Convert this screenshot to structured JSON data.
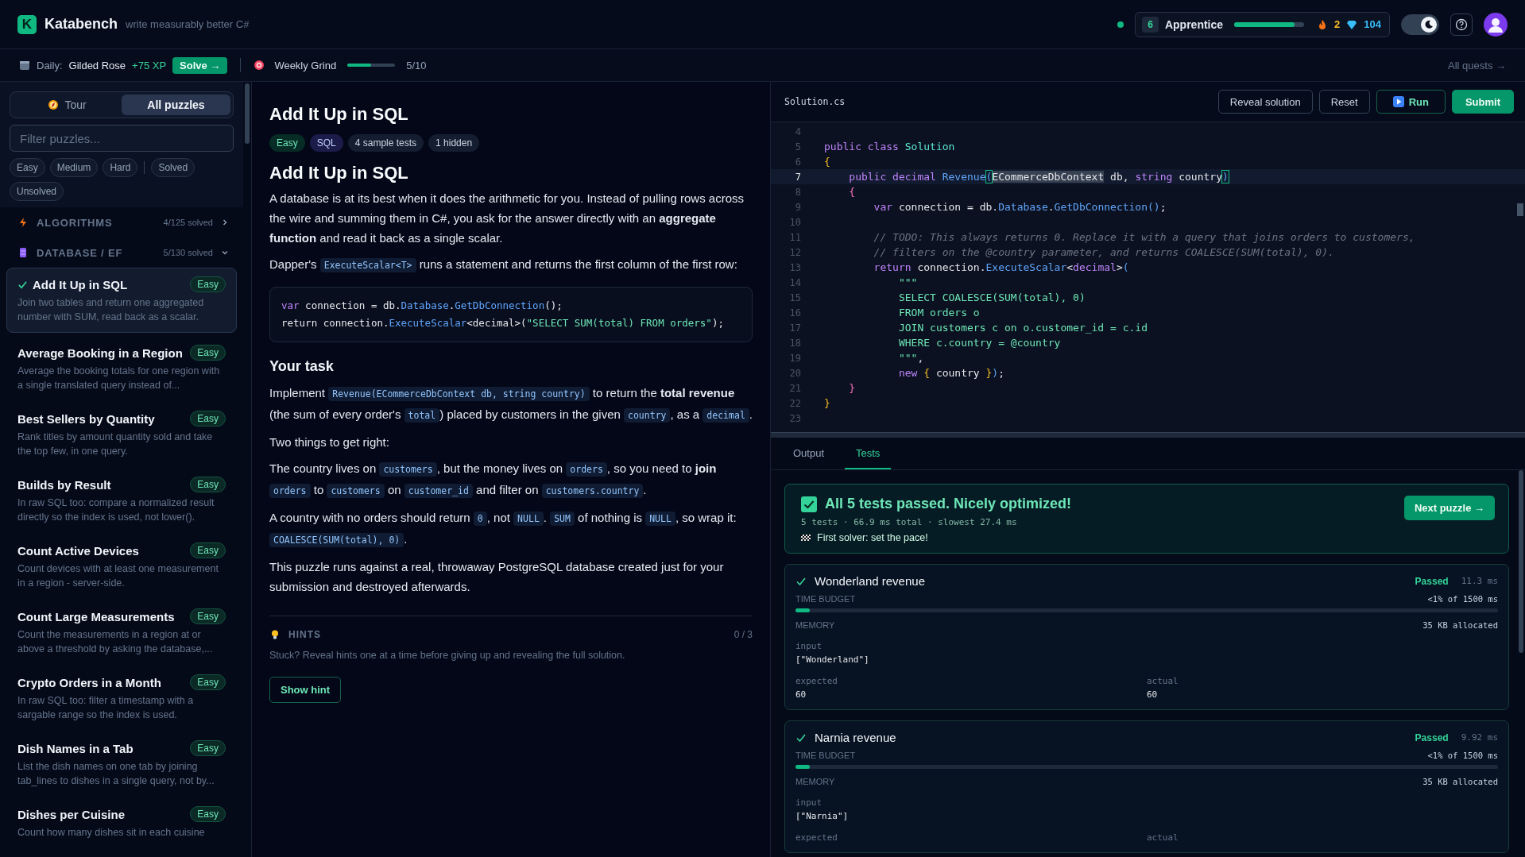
{
  "header": {
    "logo_letter": "K",
    "brand": "Katabench",
    "tagline": "write measurably better C#",
    "online": true,
    "rank_level": "6",
    "rank": "Apprentice",
    "xp": {
      "level": 0.86
    },
    "streak": "2",
    "gems": "104",
    "dark_mode": true
  },
  "quest_bar": {
    "daily_label": "Daily:",
    "daily_name": "Gilded Rose",
    "daily_xp": "+75 XP",
    "solve_button": "Solve →",
    "weekly_name": "Weekly Grind",
    "weekly": {
      "level": 0.5
    },
    "weekly_count": "5/10",
    "all_link": "All quests →"
  },
  "sidebar": {
    "view_tabs": [
      {
        "label": "Tour",
        "selected": false
      },
      {
        "label": "All puzzles",
        "selected": true
      }
    ],
    "filter": {
      "placeholder": "Filter puzzles..."
    },
    "chip_groups": [
      [
        "Easy",
        "Medium",
        "Hard"
      ],
      [
        "Solved",
        "Unsolved"
      ]
    ],
    "categories": [
      {
        "name": "ALGORITHMS",
        "solved": "4/125 solved",
        "expanded": false
      },
      {
        "name": "DATABASE / EF",
        "solved": "5/130 solved",
        "expanded": true,
        "items": [
          {
            "title": "Add It Up in SQL",
            "badge": "Easy",
            "description": "Join two tables and return one aggregated number with SUM, read back as a scalar.",
            "solved": true,
            "selected": true
          },
          {
            "title": "Average Booking in a Region",
            "badge": "Easy",
            "description": "Average the booking totals for one region with a single translated query instead of...",
            "solved": false,
            "selected": false
          },
          {
            "title": "Best Sellers by Quantity",
            "badge": "Easy",
            "description": "Rank titles by amount quantity sold and take the top few, in one query.",
            "solved": false,
            "selected": false
          },
          {
            "title": "Builds by Result",
            "badge": "Easy",
            "description": "In raw SQL too: compare a normalized result directly so the index is used, not lower().",
            "solved": false,
            "selected": false
          },
          {
            "title": "Count Active Devices",
            "badge": "Easy",
            "description": "Count devices with at least one measurement in a region - server-side.",
            "solved": false,
            "selected": false
          },
          {
            "title": "Count Large Measurements",
            "badge": "Easy",
            "description": "Count the measurements in a region at or above a threshold by asking the database,...",
            "solved": false,
            "selected": false
          },
          {
            "title": "Crypto Orders in a Month",
            "badge": "Easy",
            "description": "In raw SQL too: filter a timestamp with a sargable range so the index is used.",
            "solved": false,
            "selected": false
          },
          {
            "title": "Dish Names in a Tab",
            "badge": "Easy",
            "description": "List the dish names on one tab by joining tab_lines to dishes in a single query, not by...",
            "solved": false,
            "selected": false
          },
          {
            "title": "Dishes per Cuisine",
            "badge": "Easy",
            "description": "Count how many dishes sit in each cuisine",
            "solved": false,
            "selected": false
          }
        ]
      }
    ]
  },
  "puzzle": {
    "title": "Add It Up in SQL",
    "tags": [
      {
        "label": "Easy",
        "kind": "difficulty"
      },
      {
        "label": "SQL",
        "kind": "language"
      },
      {
        "label": "4 sample tests",
        "kind": "info"
      },
      {
        "label": "1 hidden",
        "kind": "info"
      }
    ],
    "blocks": [
      {
        "kind": "h2",
        "text": "Add It Up in SQL"
      },
      {
        "kind": "p",
        "parts": [
          {
            "kind": "text",
            "t": "A database is at its best when it does the arithmetic for you. Instead of pulling rows across the wire and summing them in C#, you ask for the answer directly with an **aggregate function** and read it back as a single scalar."
          }
        ]
      },
      {
        "kind": "p",
        "parts": [
          {
            "kind": "text",
            "t": "Dapper's "
          },
          {
            "kind": "code",
            "t": "ExecuteScalar<T>"
          },
          {
            "kind": "text",
            "t": " runs a statement and returns the first column of the first row:"
          }
        ]
      },
      {
        "kind": "code",
        "lines": [
          [
            {
              "kind": "kw",
              "t": "var "
            },
            {
              "kind": "plain",
              "t": "connection = db."
            },
            {
              "kind": "fn",
              "t": "Database"
            },
            {
              "kind": "plain",
              "t": "."
            },
            {
              "kind": "fn",
              "t": "GetDbConnection"
            },
            {
              "kind": "plain",
              "t": "();"
            }
          ],
          [
            {
              "kind": "plain",
              "t": "return connection."
            },
            {
              "kind": "fn",
              "t": "ExecuteScalar"
            },
            {
              "kind": "plain",
              "t": "<decimal>("
            },
            {
              "kind": "str",
              "t": "\"SELECT SUM(total) FROM orders\""
            },
            {
              "kind": "plain",
              "t": ");"
            }
          ]
        ]
      },
      {
        "kind": "h3",
        "text": "Your task"
      },
      {
        "kind": "p",
        "parts": [
          {
            "kind": "text",
            "t": "Implement "
          },
          {
            "kind": "code",
            "t": "Revenue(ECommerceDbContext db, string country)"
          },
          {
            "kind": "text",
            "t": " to return the **total revenue** (the sum of every order's "
          },
          {
            "kind": "code",
            "t": "total"
          },
          {
            "kind": "text",
            "t": ") placed by customers in the given "
          },
          {
            "kind": "code",
            "t": "country"
          },
          {
            "kind": "text",
            "t": ", as a "
          },
          {
            "kind": "code",
            "t": "decimal"
          },
          {
            "kind": "text",
            "t": "."
          }
        ]
      },
      {
        "kind": "p",
        "parts": [
          {
            "kind": "text",
            "t": "Two things to get right:"
          }
        ]
      },
      {
        "kind": "p",
        "parts": [
          {
            "kind": "text",
            "t": "The country lives on "
          },
          {
            "kind": "code",
            "t": "customers"
          },
          {
            "kind": "text",
            "t": ", but the money lives on "
          },
          {
            "kind": "code",
            "t": "orders"
          },
          {
            "kind": "text",
            "t": ", so you need to **join** "
          },
          {
            "kind": "code",
            "t": "orders"
          },
          {
            "kind": "text",
            "t": " to "
          },
          {
            "kind": "code",
            "t": "customers"
          },
          {
            "kind": "text",
            "t": " on "
          },
          {
            "kind": "code",
            "t": "customer_id"
          },
          {
            "kind": "text",
            "t": " and filter on "
          },
          {
            "kind": "code",
            "t": "customers.country"
          },
          {
            "kind": "text",
            "t": "."
          }
        ]
      },
      {
        "kind": "p",
        "parts": [
          {
            "kind": "text",
            "t": "A country with no orders should return "
          },
          {
            "kind": "code",
            "t": "0"
          },
          {
            "kind": "text",
            "t": ", not "
          },
          {
            "kind": "code",
            "t": "NULL"
          },
          {
            "kind": "text",
            "t": ". "
          },
          {
            "kind": "code",
            "t": "SUM"
          },
          {
            "kind": "text",
            "t": " of nothing is "
          },
          {
            "kind": "code",
            "t": "NULL"
          },
          {
            "kind": "text",
            "t": ", so wrap it: "
          },
          {
            "kind": "code",
            "t": "COALESCE(SUM(total), 0)"
          },
          {
            "kind": "text",
            "t": "."
          }
        ]
      },
      {
        "kind": "p",
        "parts": [
          {
            "kind": "text",
            "t": "This puzzle runs against a real, throwaway PostgreSQL database created just for your submission and destroyed afterwards."
          }
        ]
      }
    ],
    "hints": {
      "label": "HINTS",
      "count": "0 / 3",
      "text": "Stuck? Reveal hints one at a time before giving up and revealing the full solution.",
      "button": "Show hint"
    }
  },
  "editor": {
    "file": "Solution.cs",
    "buttons": [
      {
        "label": "Reveal solution",
        "kind": "outline"
      },
      {
        "label": "Reset",
        "kind": "outline"
      },
      {
        "label": "Run",
        "kind": "run"
      },
      {
        "label": "Submit",
        "kind": "primary"
      }
    ],
    "lines": [
      {
        "no": "4",
        "current": false
      },
      {
        "no": "5",
        "current": false,
        "tokens": [
          {
            "kind": "kw",
            "t": "public class "
          },
          {
            "kind": "type",
            "t": "Solution"
          }
        ]
      },
      {
        "no": "6",
        "current": false,
        "tokens": [
          {
            "kind": "brace",
            "t": "{"
          }
        ]
      },
      {
        "no": "7",
        "current": true,
        "tokens": [
          {
            "kind": "kw",
            "t": "    public decimal "
          },
          {
            "kind": "fn",
            "t": "Revenue"
          },
          {
            "kind": "match",
            "t": "("
          },
          {
            "kind": "sel",
            "t": "ECommerceDbContext"
          },
          {
            "kind": "plain",
            "t": " db, "
          },
          {
            "kind": "kw",
            "t": "string "
          },
          {
            "kind": "plain",
            "t": "country"
          },
          {
            "kind": "match",
            "t": ")"
          }
        ]
      },
      {
        "no": "8",
        "current": false,
        "tokens": [
          {
            "kind": "brace2",
            "t": "    {"
          }
        ]
      },
      {
        "no": "9",
        "current": false,
        "tokens": [
          {
            "kind": "kw",
            "t": "        var "
          },
          {
            "kind": "plain",
            "t": "connection = db."
          },
          {
            "kind": "fn",
            "t": "Database"
          },
          {
            "kind": "plain",
            "t": "."
          },
          {
            "kind": "fn",
            "t": "GetDbConnection"
          },
          {
            "kind": "fn",
            "t": "()"
          },
          {
            "kind": "plain",
            "t": ";"
          }
        ]
      },
      {
        "no": "10",
        "current": false
      },
      {
        "no": "11",
        "current": false,
        "tokens": [
          {
            "kind": "comment",
            "t": "        // TODO: This always returns 0. Replace it with a query that joins orders to customers,"
          }
        ]
      },
      {
        "no": "12",
        "current": false,
        "tokens": [
          {
            "kind": "comment",
            "t": "        // filters on the @country parameter, and returns COALESCE(SUM(total), 0)."
          }
        ]
      },
      {
        "no": "13",
        "current": false,
        "tokens": [
          {
            "kind": "kw",
            "t": "        return "
          },
          {
            "kind": "plain",
            "t": "connection."
          },
          {
            "kind": "fn",
            "t": "ExecuteScalar"
          },
          {
            "kind": "plain",
            "t": "<"
          },
          {
            "kind": "kw",
            "t": "decimal"
          },
          {
            "kind": "plain",
            "t": ">"
          },
          {
            "kind": "fn",
            "t": "("
          }
        ]
      },
      {
        "no": "14",
        "current": false,
        "tokens": [
          {
            "kind": "str",
            "t": "            \"\"\""
          }
        ]
      },
      {
        "no": "15",
        "current": false,
        "tokens": [
          {
            "kind": "str",
            "t": "            SELECT COALESCE(SUM(total), 0)"
          }
        ]
      },
      {
        "no": "16",
        "current": false,
        "tokens": [
          {
            "kind": "str",
            "t": "            FROM orders o"
          }
        ]
      },
      {
        "no": "17",
        "current": false,
        "tokens": [
          {
            "kind": "str",
            "t": "            JOIN customers c on o.customer_id = c.id"
          }
        ]
      },
      {
        "no": "18",
        "current": false,
        "tokens": [
          {
            "kind": "str",
            "t": "            WHERE c.country = @country"
          }
        ]
      },
      {
        "no": "19",
        "current": false,
        "tokens": [
          {
            "kind": "str",
            "t": "            \"\"\""
          },
          {
            "kind": "plain",
            "t": ","
          }
        ]
      },
      {
        "no": "20",
        "current": false,
        "tokens": [
          {
            "kind": "kw",
            "t": "            new "
          },
          {
            "kind": "brace",
            "t": "{ "
          },
          {
            "kind": "plain",
            "t": "country "
          },
          {
            "kind": "brace",
            "t": "}"
          },
          {
            "kind": "fn",
            "t": ")"
          },
          {
            "kind": "plain",
            "t": ";"
          }
        ]
      },
      {
        "no": "21",
        "current": false,
        "tokens": [
          {
            "kind": "brace2",
            "t": "    }"
          }
        ]
      },
      {
        "no": "22",
        "current": false,
        "tokens": [
          {
            "kind": "brace",
            "t": "}"
          }
        ]
      },
      {
        "no": "23",
        "current": false
      }
    ]
  },
  "results": {
    "tabs": [
      {
        "label": "Output",
        "selected": false
      },
      {
        "label": "Tests",
        "selected": true
      }
    ],
    "summary": {
      "title": "All 5 tests passed. Nicely optimized!",
      "stats": "5 tests · 66.9 ms total · slowest 27.4 ms",
      "note": "First solver: set the pace!",
      "button": "Next puzzle →"
    },
    "tests": [
      {
        "name": "Wonderland revenue",
        "passed": true,
        "status": "Passed",
        "time": "11.3 ms",
        "budget_label": "TIME BUDGET",
        "budget": {
          "level": 0.02
        },
        "budget_text": "<1% of 1500 ms",
        "memory_label": "MEMORY",
        "memory": "35 KB allocated",
        "input_label": "input",
        "input": "[\"Wonderland\"]",
        "expected_label": "expected",
        "expected": "60",
        "actual_label": "actual",
        "actual": "60"
      },
      {
        "name": "Narnia revenue",
        "passed": true,
        "status": "Passed",
        "time": "9.92 ms",
        "budget_label": "TIME BUDGET",
        "budget": {
          "level": 0.02
        },
        "budget_text": "<1% of 1500 ms",
        "memory_label": "MEMORY",
        "memory": "35 KB allocated",
        "input_label": "input",
        "input": "[\"Narnia\"]",
        "expected_label": "expected",
        "actual_label": "actual"
      }
    ]
  }
}
